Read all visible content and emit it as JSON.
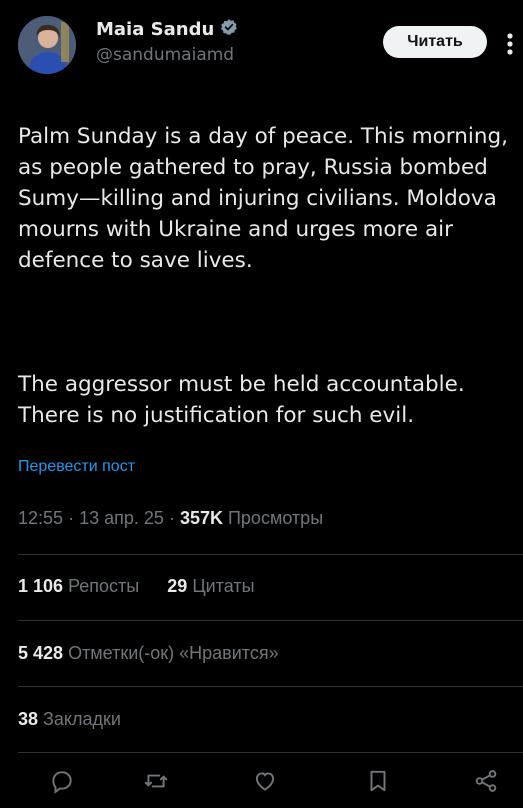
{
  "profile": {
    "name": "Maia Sandu",
    "handle": "@sandumaiamd",
    "follow_label": "Читать"
  },
  "tweet": {
    "paragraph_1": "Palm Sunday is a day of peace. This morning, as people gathered to pray, Russia bombed Sumy—killing and injuring civilians. Moldova mourns with Ukraine and urges more air defence to save lives.",
    "paragraph_2": "The aggressor must be held accountable. There is no justification for such evil.",
    "translate_label": "Перевести пост"
  },
  "meta": {
    "time": "12:55",
    "date": "13 апр. 25",
    "views_count": "357K",
    "views_label": "Просмотры",
    "separator": "·"
  },
  "stats": {
    "reposts_count": "1 106",
    "reposts_label": "Репосты",
    "quotes_count": "29",
    "quotes_label": "Цитаты",
    "likes_count": "5 428",
    "likes_label": "Отметки(-ок) «Нравится»",
    "bookmarks_count": "38",
    "bookmarks_label": "Закладки"
  },
  "actions": [
    "reply-icon",
    "repost-icon",
    "like-icon",
    "bookmark-icon",
    "share-icon"
  ],
  "colors": {
    "background": "#000000",
    "text": "#e7e9ea",
    "secondary": "#71767b",
    "link": "#1d9bf0",
    "divider": "#2f3336",
    "verified": "#829aab"
  }
}
